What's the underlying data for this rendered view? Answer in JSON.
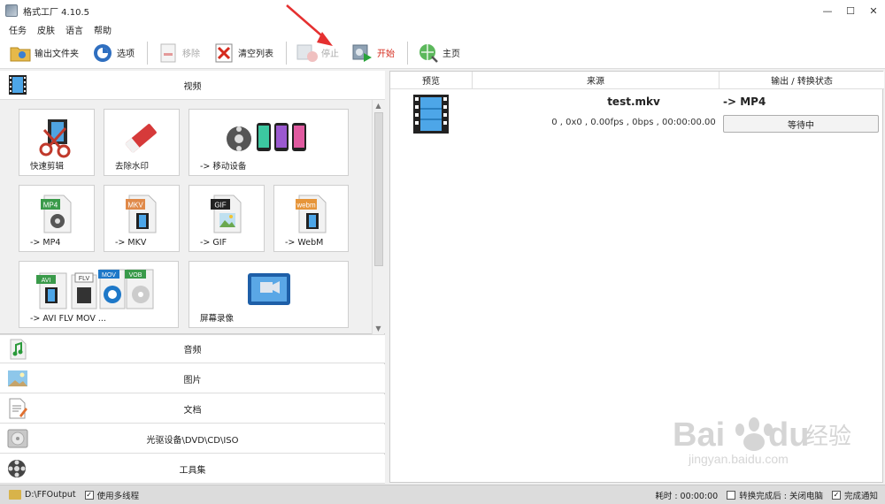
{
  "window": {
    "title": "格式工厂 4.10.5"
  },
  "menu": [
    "任务",
    "皮肤",
    "语言",
    "帮助"
  ],
  "toolbar": {
    "output_folder": "输出文件夹",
    "options": "选项",
    "remove": "移除",
    "clear_list": "清空列表",
    "stop": "停止",
    "start": "开始",
    "home": "主页"
  },
  "categories": {
    "video": "视频",
    "audio": "音频",
    "picture": "图片",
    "document": "文档",
    "rom": "光驱设备\\DVD\\CD\\ISO",
    "tools": "工具集"
  },
  "video_tiles": {
    "quick_clip": "快速剪辑",
    "remove_watermark": "去除水印",
    "mobile": "-> 移动设备",
    "mp4": "-> MP4",
    "mkv": "-> MKV",
    "gif": "-> GIF",
    "webm": "-> WebM",
    "multi": "-> AVI FLV MOV ...",
    "screen_record": "屏幕录像",
    "badge_mp4": "MP4",
    "badge_mkv": "MKV",
    "badge_gif": "GIF",
    "badge_webm": "webm",
    "badge_avi": "AVI",
    "badge_flv": "FLV",
    "badge_mov": "MOV",
    "badge_vob": "VOB"
  },
  "task_list": {
    "columns": [
      "预览",
      "来源",
      "输出 / 转换状态"
    ],
    "rows": [
      {
        "file": "test.mkv",
        "info": "0 , 0x0 , 0.00fps , 0bps , 00:00:00.00",
        "target": "-> MP4",
        "status": "等待中"
      }
    ]
  },
  "statusbar": {
    "output_path": "D:\\FFOutput",
    "multithread_label": "使用多线程",
    "elapsed": "耗时 : 00:00:00",
    "after_convert": "转换完成后 : 关闭电脑",
    "notify": "完成通知"
  },
  "watermark": {
    "brand_left": "Bai",
    "brand_right": "du",
    "cn": "经验",
    "url": "jingyan.baidu.com"
  },
  "colors": {
    "start_red": "#d52b1e",
    "accent_blue": "#1e78c8",
    "status_gray": "#dcdcdc"
  }
}
